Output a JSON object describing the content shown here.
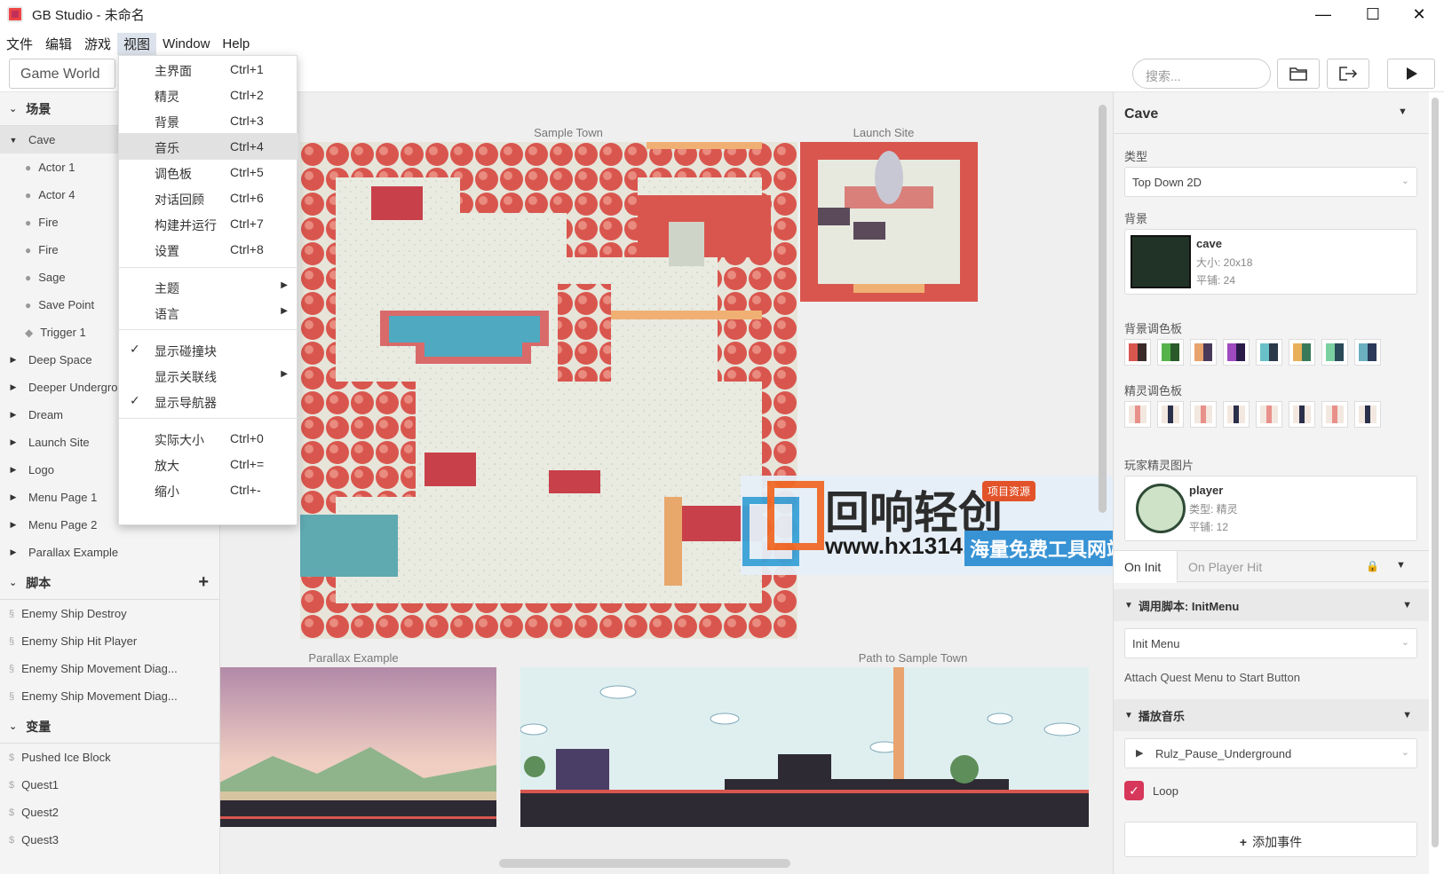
{
  "window": {
    "title": "GB Studio - 未命名",
    "minimize": "—",
    "maximize": "☐",
    "close": "✕"
  },
  "menubar": [
    "文件",
    "编辑",
    "游戏",
    "视图",
    "Window",
    "Help"
  ],
  "toolbar": {
    "world_label": "Game World",
    "search_placeholder": "搜索..."
  },
  "sidebar": {
    "scenes_heading": "场景",
    "scenes": [
      {
        "label": "Cave",
        "expanded": true,
        "children": [
          {
            "label": "Actor 1",
            "icon": "actor-icon"
          },
          {
            "label": "Actor 4",
            "icon": "actor-icon"
          },
          {
            "label": "Fire",
            "icon": "actor-icon"
          },
          {
            "label": "Fire",
            "icon": "actor-icon"
          },
          {
            "label": "Sage",
            "icon": "actor-icon"
          },
          {
            "label": "Save Point",
            "icon": "actor-icon"
          },
          {
            "label": "Trigger 1",
            "icon": "trigger-icon"
          }
        ]
      },
      {
        "label": "Deep Space"
      },
      {
        "label": "Deeper Undergro"
      },
      {
        "label": "Dream"
      },
      {
        "label": "Launch Site"
      },
      {
        "label": "Logo"
      },
      {
        "label": "Menu Page 1"
      },
      {
        "label": "Menu Page 2"
      },
      {
        "label": "Parallax Example"
      }
    ],
    "scripts_heading": "脚本",
    "scripts_add": "+",
    "scripts": [
      "Enemy Ship Destroy",
      "Enemy Ship Hit Player",
      "Enemy Ship Movement Diag...",
      "Enemy Ship Movement Diag..."
    ],
    "variables_heading": "变量",
    "variables": [
      "Pushed Ice Block",
      "Quest1",
      "Quest2",
      "Quest3"
    ]
  },
  "view_menu": {
    "items": [
      {
        "label": "主界面",
        "shortcut": "Ctrl+1"
      },
      {
        "label": "精灵",
        "shortcut": "Ctrl+2"
      },
      {
        "label": "背景",
        "shortcut": "Ctrl+3"
      },
      {
        "label": "音乐",
        "shortcut": "Ctrl+4",
        "highlighted": true
      },
      {
        "label": "调色板",
        "shortcut": "Ctrl+5"
      },
      {
        "label": "对话回顾",
        "shortcut": "Ctrl+6"
      },
      {
        "label": "构建并运行",
        "shortcut": "Ctrl+7"
      },
      {
        "label": "设置",
        "shortcut": "Ctrl+8"
      }
    ],
    "submenus": [
      {
        "label": "主题",
        "has_submenu": true
      },
      {
        "label": "语言",
        "has_submenu": true
      }
    ],
    "toggles": [
      {
        "label": "显示碰撞块",
        "checked": true
      },
      {
        "label": "显示关联线",
        "checked": false,
        "has_submenu": true
      },
      {
        "label": "显示导航器",
        "checked": true
      }
    ],
    "zoom": [
      {
        "label": "实际大小",
        "shortcut": "Ctrl+0"
      },
      {
        "label": "放大",
        "shortcut": "Ctrl+="
      },
      {
        "label": "缩小",
        "shortcut": "Ctrl+-"
      }
    ]
  },
  "canvas": {
    "scenes": [
      "Sample Town",
      "Launch Site",
      "Parallax Example",
      "Path to Sample Town"
    ]
  },
  "watermark": {
    "brand": "回响轻创",
    "badge": "项目资源",
    "url": "www.hx1314.cc",
    "tagline": "海量免费工具网站"
  },
  "properties": {
    "scene_name": "Cave",
    "type_label": "类型",
    "type_value": "Top Down 2D",
    "background_label": "背景",
    "background": {
      "name": "cave",
      "size": "大小: 20x18",
      "tiles": "平铺: 24"
    },
    "bg_palettes_label": "背景调色板",
    "sprite_palettes_label": "精灵调色板",
    "player_sprite_label": "玩家精灵图片",
    "player": {
      "name": "player",
      "type": "类型: 精灵",
      "tiles": "平铺: 12"
    },
    "tabs": [
      "On Init",
      "On Player Hit"
    ],
    "event1": {
      "title": "调用脚本: InitMenu",
      "value": "Init Menu",
      "desc": "Attach Quest Menu to Start Button"
    },
    "event2": {
      "title": "播放音乐",
      "value": "Rulz_Pause_Underground",
      "loop_label": "Loop",
      "loop_checked": true
    },
    "add_event": "添加事件"
  },
  "colors": {
    "accent_red": "#d23a3a",
    "selected": "#e4e4e4",
    "loop_check": "#d6375a"
  }
}
